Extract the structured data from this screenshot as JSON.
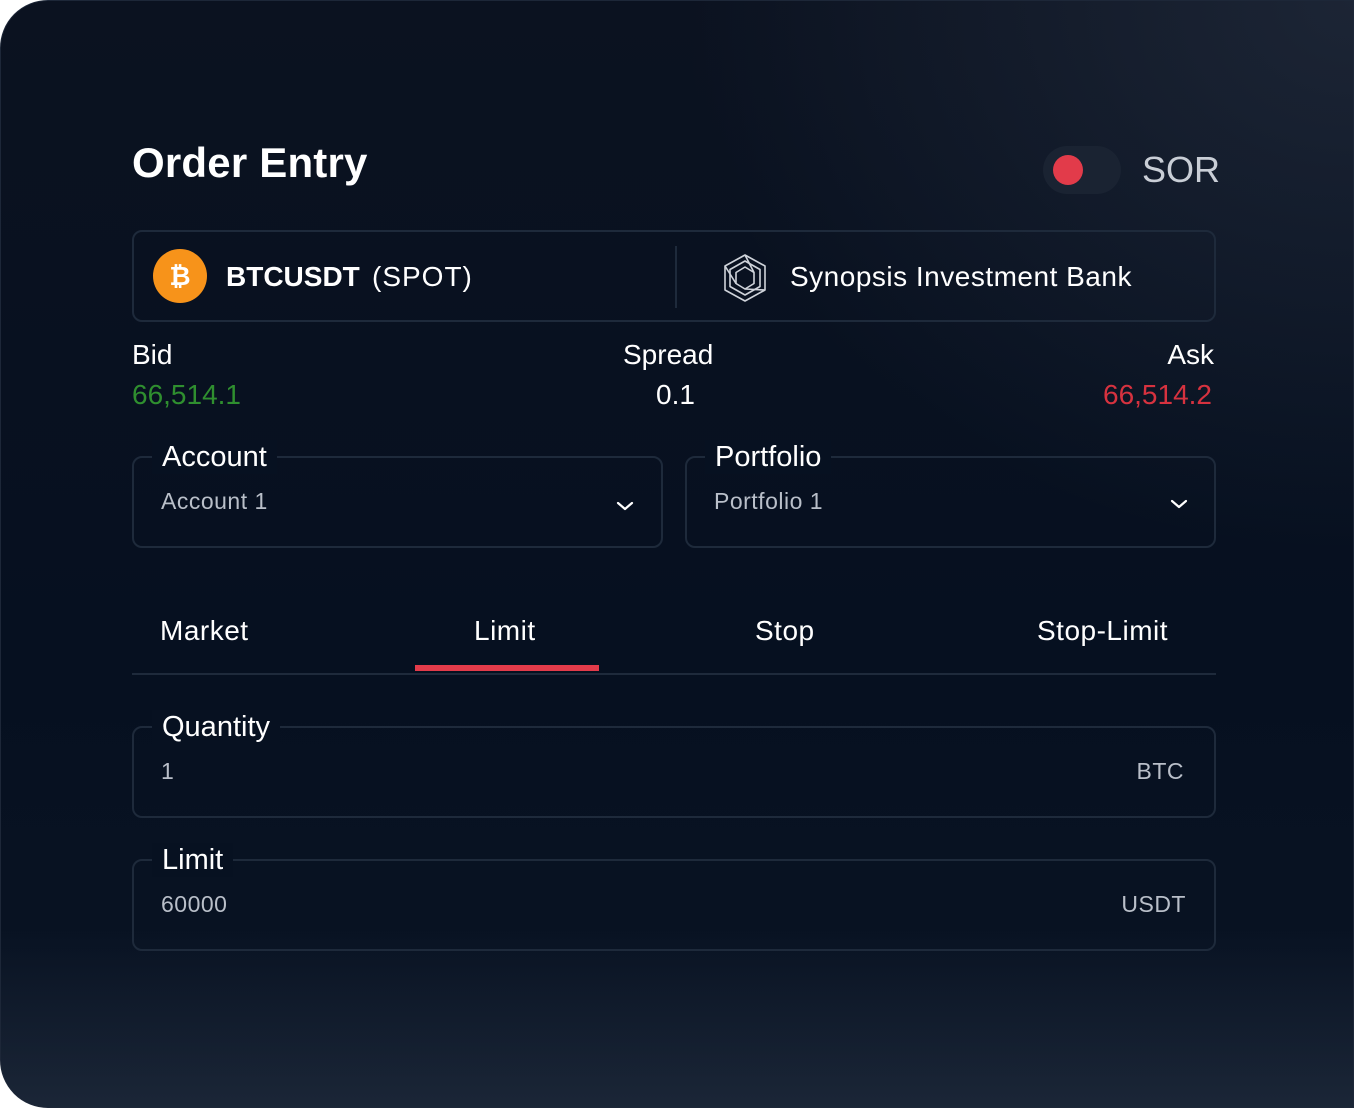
{
  "header": {
    "title": "Order Entry",
    "sor_label": "SOR",
    "sor_enabled": false
  },
  "instrument": {
    "symbol": "BTCUSDT",
    "market_type": "(SPOT)",
    "coin_icon": "bitcoin-icon",
    "coin_glyph": "₿",
    "venue_icon": "synopsis-bank-logo-icon",
    "venue_name": "Synopsis Investment Bank"
  },
  "quote": {
    "bid_label": "Bid",
    "bid_value": "66,514.1",
    "spread_label": "Spread",
    "spread_value": "0.1",
    "ask_label": "Ask",
    "ask_value": "66,514.2"
  },
  "account": {
    "label": "Account",
    "value": "Account 1"
  },
  "portfolio": {
    "label": "Portfolio",
    "value": "Portfolio 1"
  },
  "order_types": {
    "tabs": [
      "Market",
      "Limit",
      "Stop",
      "Stop-Limit"
    ],
    "selected": "Limit"
  },
  "quantity": {
    "label": "Quantity",
    "value": "1",
    "unit": "BTC"
  },
  "limit": {
    "label": "Limit",
    "value": "60000",
    "unit": "USDT"
  },
  "colors": {
    "bid": "#2f8f2f",
    "ask": "#d6323f",
    "accent": "#e23b4a",
    "toggle_knob": "#e23b4a",
    "bitcoin": "#f7931a"
  }
}
